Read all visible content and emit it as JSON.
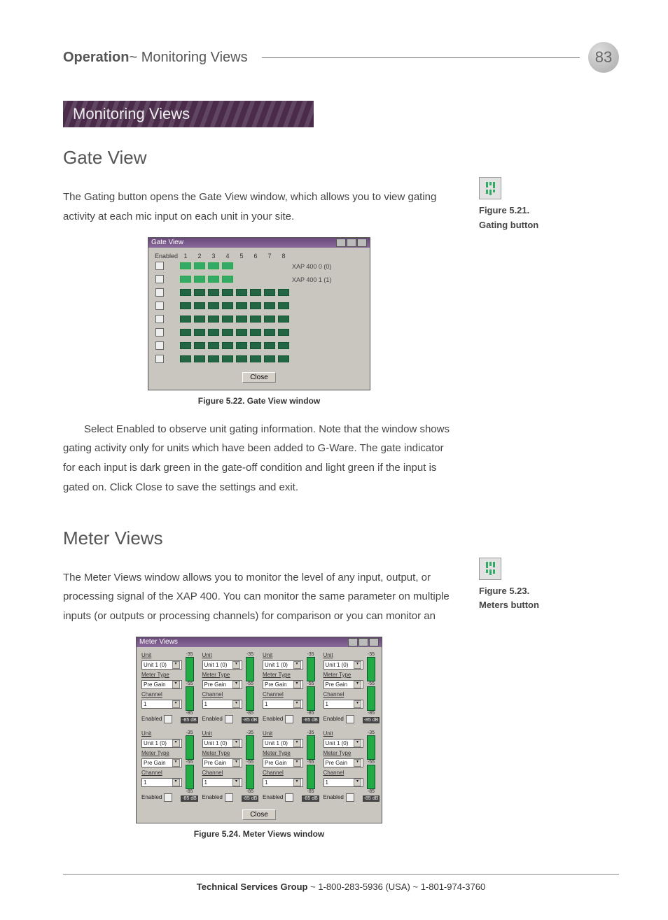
{
  "header": {
    "chapter": "Operation",
    "section": "Monitoring Views",
    "page_number": "83"
  },
  "banner": "Monitoring Views",
  "gate": {
    "heading": "Gate View",
    "intro": "The Gating button opens the Gate View window, which allows you to view gating activity at each mic input on each unit in your site.",
    "side_fig_num": "Figure 5.21.",
    "side_fig_label": "Gating button",
    "win_title": "Gate View",
    "hdr_enabled": "Enabled",
    "cols": [
      "1",
      "2",
      "3",
      "4",
      "5",
      "6",
      "7",
      "8"
    ],
    "unit_labels": [
      "XAP 400 0 (0)",
      "XAP 400 1 (1)"
    ],
    "close": "Close",
    "caption": "Figure 5.22. Gate View window",
    "para2": "Select Enabled to observe unit gating information. Note that the window shows gating activity only for units which have been added to G-Ware. The gate indicator for each input is dark green in the gate-off condition and light green if the input is gated on. Click Close to save the settings and exit."
  },
  "meter": {
    "heading": "Meter Views",
    "intro": "The Meter Views window allows you to monitor the level of any input, output, or processing signal of the XAP 400. You can monitor the same parameter on multiple inputs (or outputs or processing channels) for comparison or you can monitor an",
    "side_fig_num": "Figure 5.23.",
    "side_fig_label": "Meters button",
    "win_title": "Meter Views",
    "unit_lbl": "Unit",
    "unit_val": "Unit 1  (0)",
    "type_lbl": "Meter Type",
    "type_val": "Pre Gain",
    "chan_lbl": "Channel",
    "chan_val": "1",
    "enabled_lbl": "Enabled",
    "tick_hi": "-35",
    "tick_mid": "-55",
    "tick_lo": "-85",
    "readout": "-85 dB",
    "close": "Close",
    "caption": "Figure 5.24. Meter Views window"
  },
  "footer": {
    "group": "Technical Services Group",
    "sep": " ~ ",
    "phone1": "1-800-283-5936 (USA)",
    "phone2": "1-801-974-3760"
  }
}
